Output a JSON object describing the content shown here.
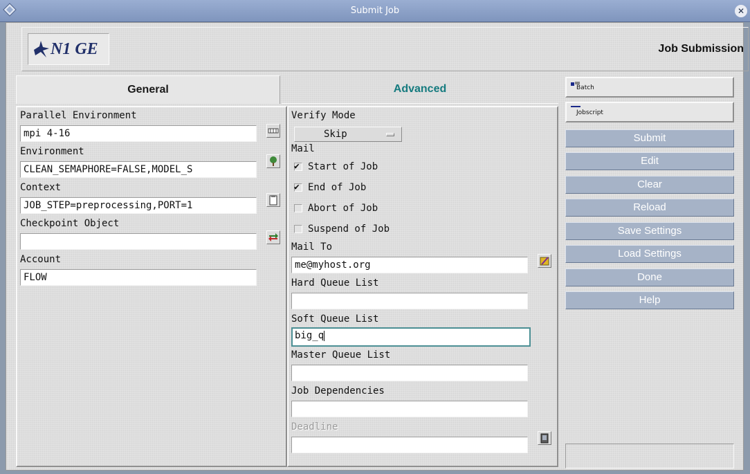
{
  "window": {
    "title": "Submit Job"
  },
  "header": {
    "logo_text": "N1 GE",
    "title": "Job Submission"
  },
  "tabs": [
    {
      "label": "General",
      "active": true
    },
    {
      "label": "Advanced",
      "active": false
    }
  ],
  "general": {
    "parallel_env": {
      "label": "Parallel Environment",
      "value": "mpi 4-16"
    },
    "environment": {
      "label": "Environment",
      "value": "CLEAN_SEMAPHORE=FALSE,MODEL_S"
    },
    "context": {
      "label": "Context",
      "value": "JOB_STEP=preprocessing,PORT=1"
    },
    "checkpoint": {
      "label": "Checkpoint Object",
      "value": ""
    },
    "account": {
      "label": "Account",
      "value": "FLOW"
    }
  },
  "advanced": {
    "verify_mode": {
      "label": "Verify Mode",
      "value": "Skip"
    },
    "mail": {
      "label": "Mail",
      "options": [
        {
          "label": "Start of Job",
          "checked": true
        },
        {
          "label": "End of Job",
          "checked": true
        },
        {
          "label": "Abort of Job",
          "checked": false
        },
        {
          "label": "Suspend of Job",
          "checked": false
        }
      ]
    },
    "mail_to": {
      "label": "Mail To",
      "value": "me@myhost.org"
    },
    "hard_queue": {
      "label": "Hard Queue List",
      "value": ""
    },
    "soft_queue": {
      "label": "Soft Queue List",
      "value": "big_q"
    },
    "master_queue": {
      "label": "Master Queue List",
      "value": ""
    },
    "job_deps": {
      "label": "Job Dependencies",
      "value": ""
    },
    "deadline": {
      "label": "Deadline",
      "value": ""
    }
  },
  "sidebar": {
    "modes": [
      {
        "label": "Batch"
      },
      {
        "label": "Jobscript"
      }
    ],
    "buttons": [
      "Submit",
      "Edit",
      "Clear",
      "Reload",
      "Save Settings",
      "Load Settings",
      "Done",
      "Help"
    ]
  },
  "colors": {
    "titlebar": "#8aa0c8",
    "advanced_tab_text": "#157b7f",
    "action_button": "#a6b3c7"
  }
}
